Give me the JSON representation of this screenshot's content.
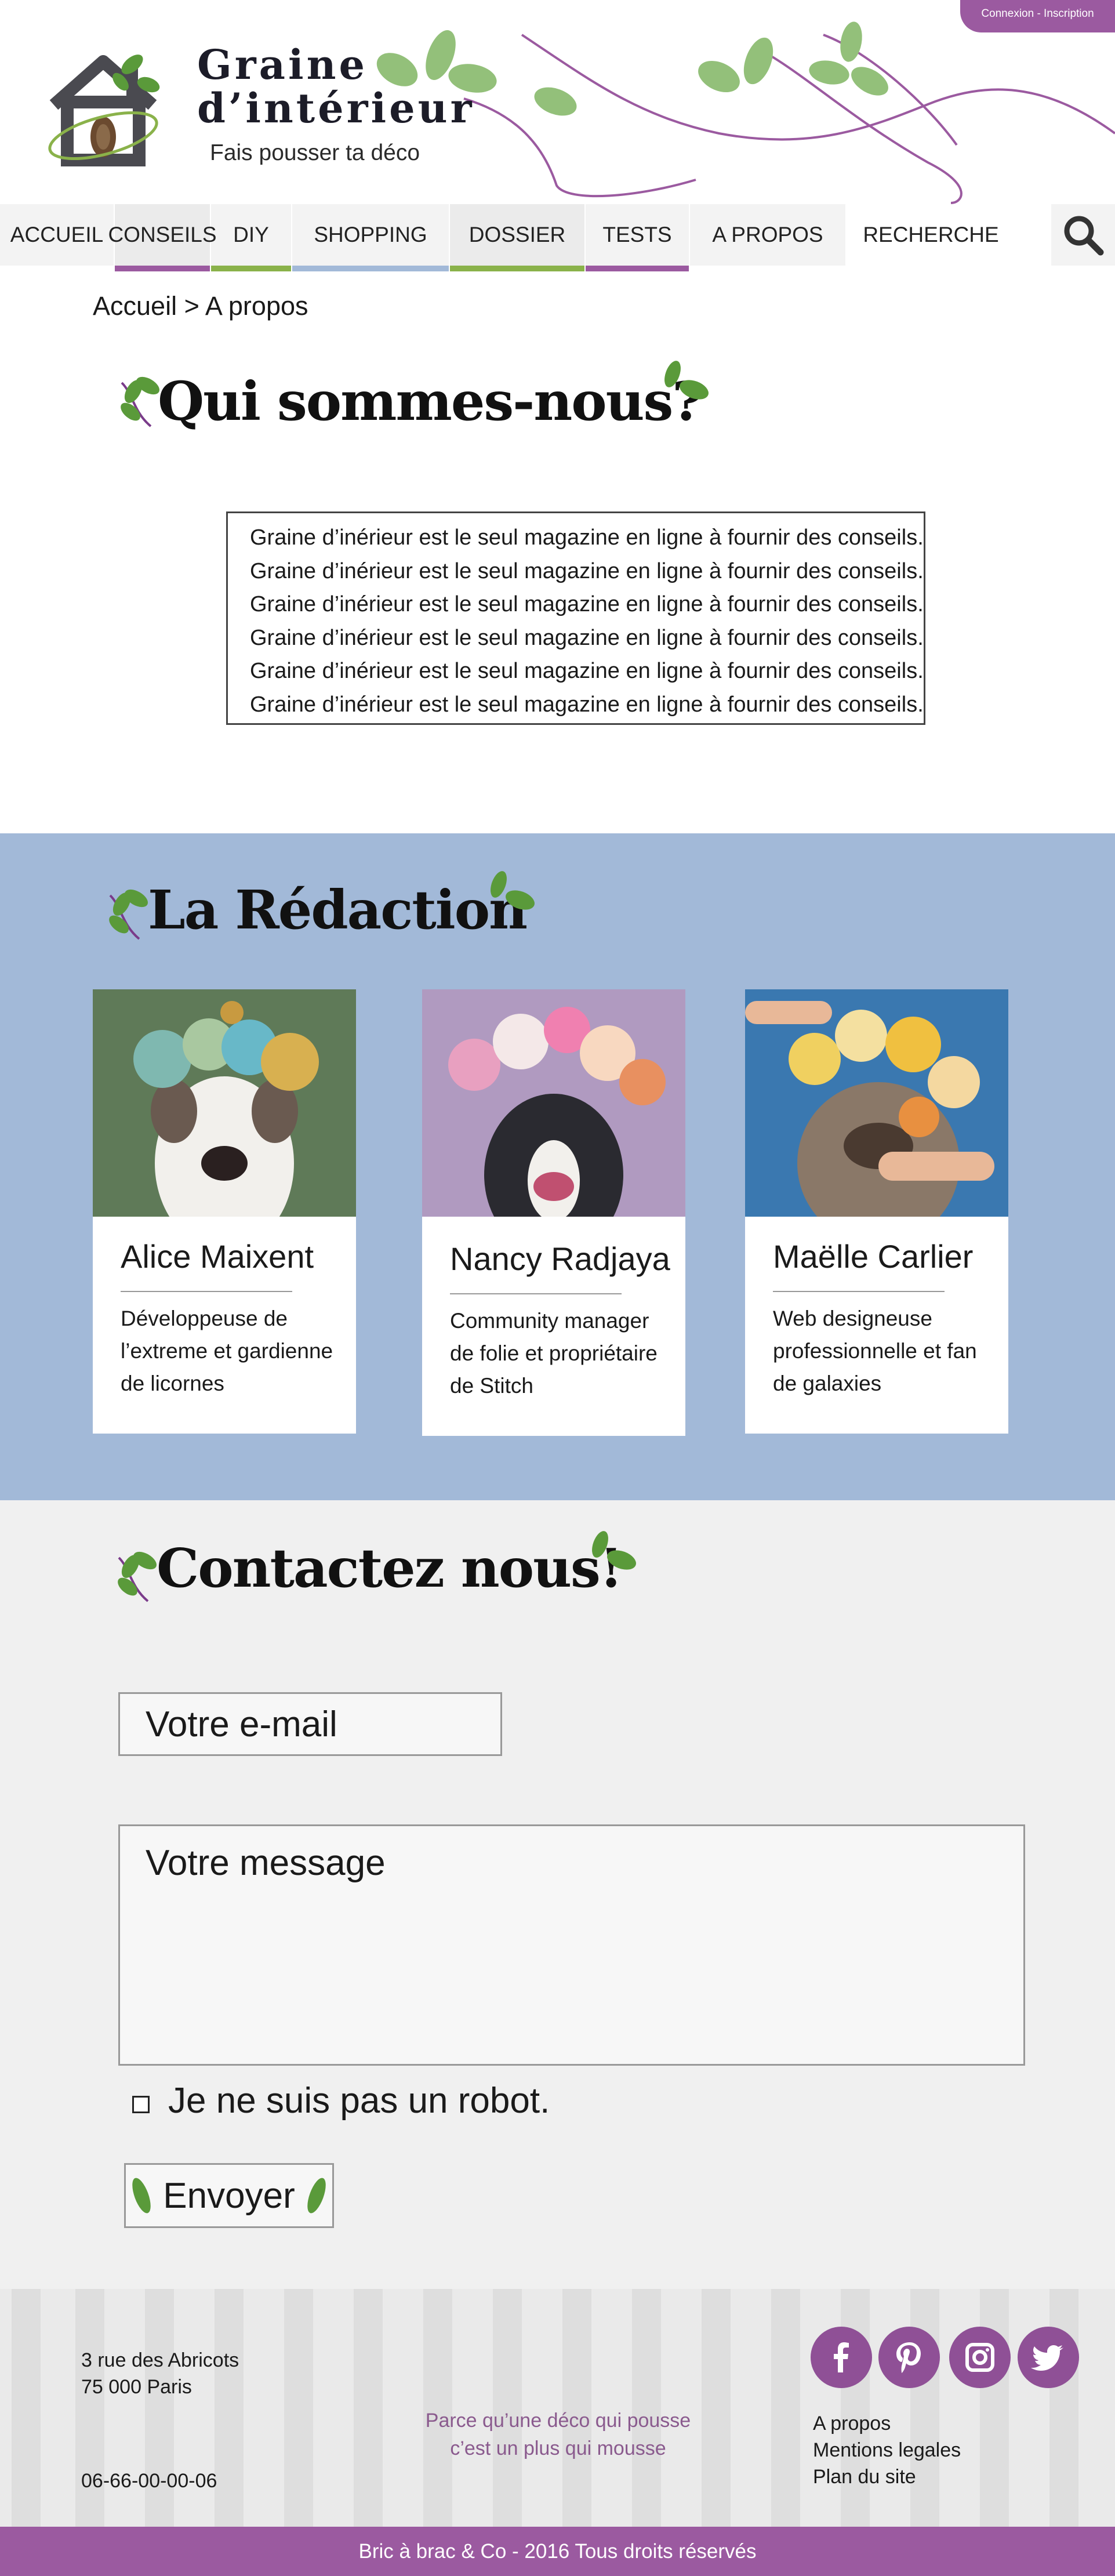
{
  "header": {
    "login_link": "Connexion - Inscription",
    "brand_line1": "Graine",
    "brand_line2": "d’intérieur",
    "tagline": "Fais pousser ta déco"
  },
  "nav": {
    "items": [
      {
        "label": "ACCUEIL"
      },
      {
        "label": "CONSEILS",
        "accent": "#9b5aa0"
      },
      {
        "label": "DIY",
        "accent": "#8ab24a"
      },
      {
        "label": "SHOPPING",
        "accent": "#a2b9d8"
      },
      {
        "label": "DOSSIER",
        "accent": "#8ab24a"
      },
      {
        "label": "TESTS",
        "accent": "#9b5aa0"
      },
      {
        "label": "A PROPOS"
      }
    ],
    "search_label": "RECHERCHE",
    "search_icon": "search-icon"
  },
  "breadcrumb": "Accueil > A propos",
  "about": {
    "title": "Qui sommes-nous?",
    "lines": [
      "Graine d’inérieur est le seul magazine en ligne à fournir des conseils.",
      "Graine d’inérieur est le seul magazine en ligne à fournir des conseils.",
      "Graine d’inérieur est le seul magazine en ligne à fournir des conseils.",
      "Graine d’inérieur est le seul magazine en ligne à fournir des conseils.",
      "Graine d’inérieur est le seul magazine en ligne à fournir des conseils.",
      "Graine d’inérieur est le seul magazine en ligne à fournir des conseils."
    ]
  },
  "team": {
    "title": "La Rédaction",
    "members": [
      {
        "name": "Alice Maixent",
        "role": "Développeuse de l’extreme et gardienne de licornes"
      },
      {
        "name": "Nancy Radjaya",
        "role": "Community manager de folie et propriétaire de Stitch"
      },
      {
        "name": "Maëlle Carlier",
        "role": "Web designeuse professionnelle et fan de galaxies"
      }
    ]
  },
  "contact": {
    "title": "Contactez nous!",
    "email_placeholder": "Votre e-mail",
    "message_placeholder": "Votre message",
    "robot_label": "Je ne suis pas un robot.",
    "send_label": "Envoyer"
  },
  "footer": {
    "address_line1": "3 rue des Abricots",
    "address_line2": "75 000 Paris",
    "phone": "06-66-00-00-06",
    "slogan_line1": "Parce qu’une déco qui pousse",
    "slogan_line2": "c’est un plus qui mousse",
    "links": [
      "A propos",
      "Mentions legales",
      "Plan du site"
    ],
    "social_icons": [
      "facebook-icon",
      "pinterest-icon",
      "instagram-icon",
      "twitter-icon"
    ],
    "copyright": "Bric à brac & Co - 2016 Tous droits réservés"
  },
  "colors": {
    "purple": "#9b5aa0",
    "leaf_green": "#5a9a3a",
    "light_green": "#8ab24a",
    "team_blue": "#a2b9d8"
  }
}
